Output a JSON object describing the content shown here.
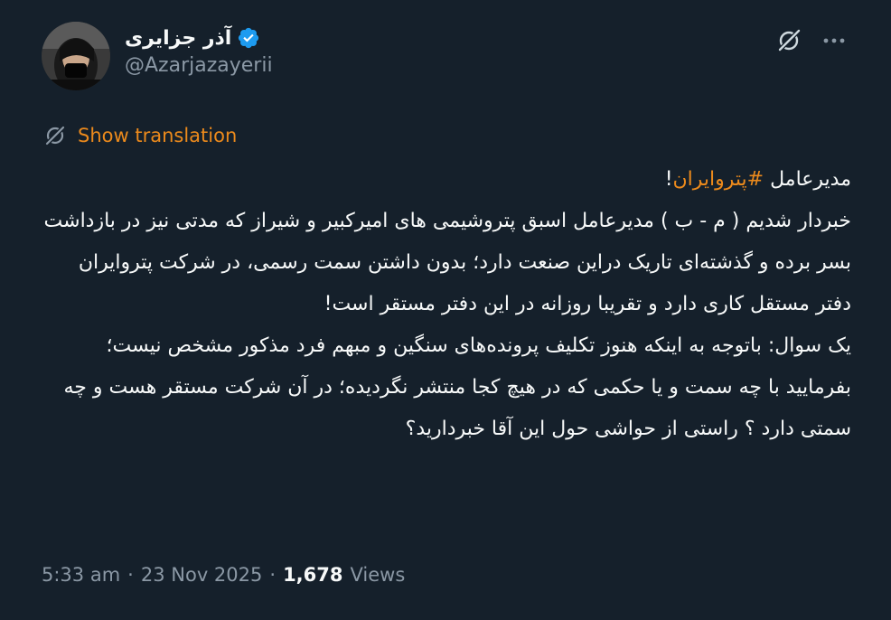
{
  "author": {
    "display_name": "آذر جزایری",
    "handle": "@Azarjazayerii",
    "verified": true,
    "verified_color": "#1d9bf0"
  },
  "icons": {
    "grok": "grok-icon",
    "more": "more-dots-icon",
    "translate": "translate-globe-icon",
    "verified": "verified-badge-icon"
  },
  "translation": {
    "label": "Show translation"
  },
  "tweet": {
    "line1_prefix": "مدیرعامل ",
    "hashtag": "#پتروایران",
    "line1_suffix": "!",
    "body": "خبردار شدیم ( م - ب ) مدیرعامل اسبق پتروشیمی های امیرکبیر و شیراز که مدتی نیز در بازداشت بسر برده و گذشته‌ای تاریک دراین صنعت دارد؛ بدون داشتن سمت رسمی، در شرکت پتروایران دفتر مستقل کاری دارد و تقریبا روزانه در این دفتر مستقر است!\nیک سوال: باتوجه به اینکه هنوز تکلیف پرونده‌های سنگین و  مبهم فرد مذکور مشخص نیست؛بفرمایید با چه سمت و یا حکمی که در هیچ کجا منتشر نگردیده؛ در آن شرکت مستقر هست و چه سمتی دارد ؟ راستی از حواشی حول این آقا خبردارید؟"
  },
  "meta": {
    "time": "5:33 am",
    "separator": "·",
    "date": "23 Nov 2025",
    "views_count": "1,678",
    "views_label": "Views"
  },
  "colors": {
    "background": "#15202b",
    "accent": "#ec8a1c",
    "muted": "#8b98a5",
    "text": "#f7f9f9"
  }
}
